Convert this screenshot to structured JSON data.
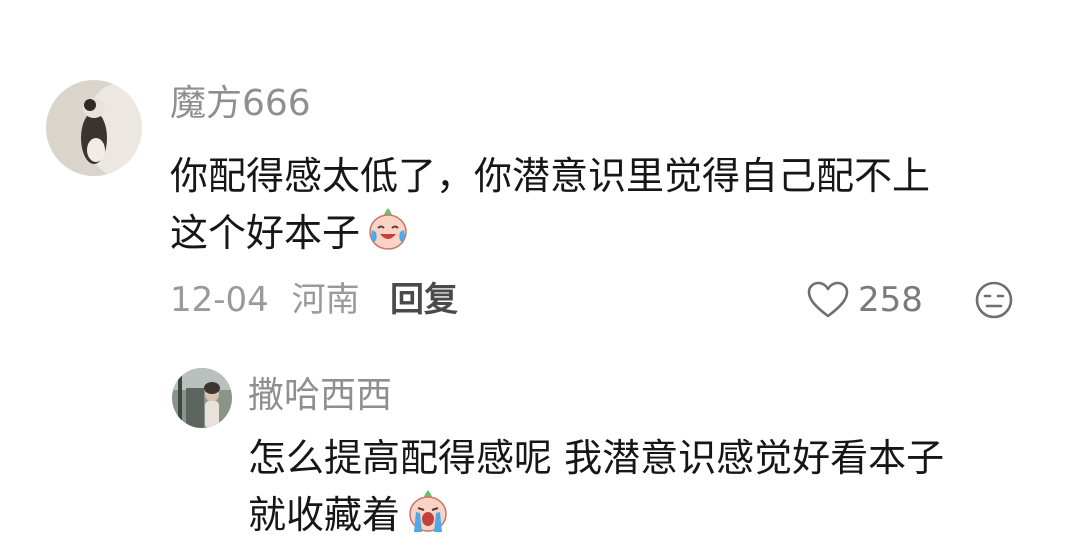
{
  "comment": {
    "username": "魔方666",
    "text_line1": "你配得感太低了，你潜意识里觉得自己配不上",
    "text_line2": "这个好本子",
    "text_emoji": "laughing-tears-peach-emoji",
    "date": "12-04",
    "location": "河南",
    "reply_label": "回复",
    "like_count": "258",
    "like_icon": "heart-outline-icon",
    "dislike_icon": "neutral-face-icon"
  },
  "reply": {
    "username": "撒哈西西",
    "text_line1": "怎么提高配得感呢 我潜意识感觉好看本子",
    "text_line2": "就收藏着",
    "text_emoji": "crying-peach-emoji"
  }
}
